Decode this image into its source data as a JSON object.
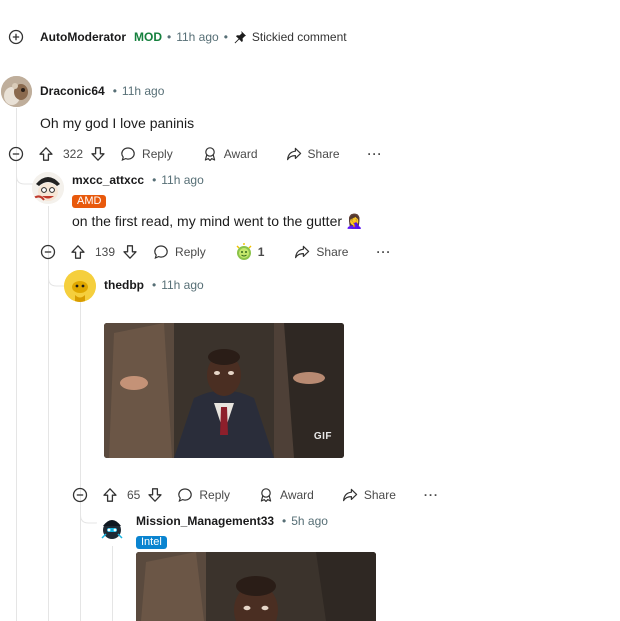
{
  "sticky": {
    "author": "AutoModerator",
    "mod_label": "MOD",
    "age": "11h ago",
    "status": "Stickied comment"
  },
  "c1": {
    "author": "Draconic64",
    "age": "11h ago",
    "text": "Oh my god I love paninis",
    "score": "322",
    "reply_label": "Reply",
    "award_label": "Award",
    "share_label": "Share",
    "more_label": "···"
  },
  "c2": {
    "author": "mxcc_attxcc",
    "flair": "AMD",
    "age": "11h ago",
    "text": "on the first read, my mind went to the gutter 🤦‍♀️",
    "score": "139",
    "reply_label": "Reply",
    "award_count": "1",
    "share_label": "Share",
    "more_label": "···"
  },
  "c3": {
    "author": "thedbp",
    "age": "11h ago",
    "gif_badge": "GIF",
    "score": "65",
    "reply_label": "Reply",
    "award_label": "Award",
    "share_label": "Share",
    "more_label": "···"
  },
  "c4": {
    "author": "Mission_Management33",
    "flair": "Intel",
    "age": "5h ago"
  },
  "colors": {
    "mod_green": "#15803d",
    "amd_flair": "#e8590c",
    "intel_flair": "#0a84d0",
    "thread_line": "#e5e5e5",
    "meta_gray": "#576f76"
  },
  "icons": [
    "expand-icon",
    "collapse-icon",
    "pin-icon",
    "upvote-icon",
    "downvote-icon",
    "reply-icon",
    "award-icon",
    "share-icon",
    "more-icon",
    "award-emoji-icon"
  ]
}
